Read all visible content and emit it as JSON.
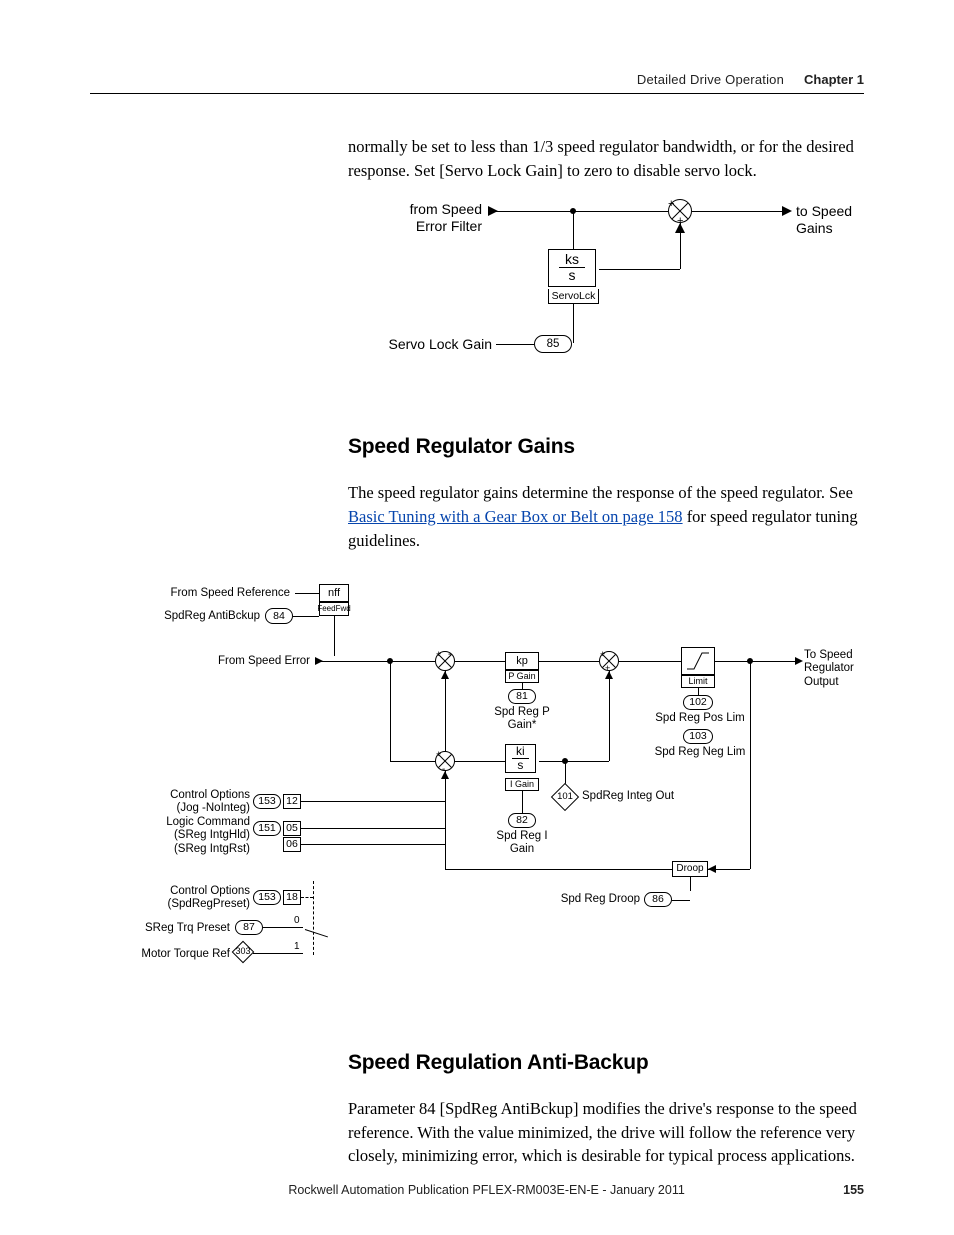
{
  "header": {
    "section": "Detailed Drive Operation",
    "chapter": "Chapter 1"
  },
  "para1": "normally be set to less than 1/3 speed regulator bandwidth, or for the desired response. Set [Servo Lock Gain] to zero to disable servo lock.",
  "diag1": {
    "from_label_a": "from Speed",
    "from_label_b": "Error Filter",
    "to_label": "to Speed Gains",
    "ks": "ks",
    "s": "s",
    "servolck": "ServoLck",
    "servo_lock_gain": "Servo Lock Gain",
    "param85": "85",
    "plus": "+"
  },
  "h3a": "Speed Regulator Gains",
  "para2a": "The speed regulator gains determine the response of the speed regulator. See ",
  "para2_link": "Basic Tuning with a Gear Box or Belt on page 158",
  "para2b": " for speed regulator tuning guidelines.",
  "diag2": {
    "from_speed_ref": "From Speed Reference",
    "spdreg_antibckup": "SpdReg AntiBckup",
    "nff": "nff",
    "feedfwd": "FeedFwd",
    "p84": "84",
    "from_speed_error": "From Speed Error",
    "kp": "kp",
    "pgain": "P Gain",
    "p81": "81",
    "spd_reg_p_gain": "Spd Reg P Gain*",
    "limit": "Limit",
    "to_speed_reg_out_a": "To Speed",
    "to_speed_reg_out_b": "Regulator Output",
    "p102": "102",
    "spd_reg_pos_lim": "Spd Reg Pos Lim",
    "p103": "103",
    "spd_reg_neg_lim": "Spd Reg Neg Lim",
    "ki": "ki",
    "s": "s",
    "igain": "I Gain",
    "p101": "101",
    "spdreg_integ_out": "SpdReg Integ Out",
    "p82": "82",
    "spd_reg_i_gain": "Spd Reg I Gain",
    "control_options_nointeg_a": "Control Options",
    "control_options_nointeg_b": "(Jog -NoInteg)",
    "p153": "153",
    "b12": "12",
    "logic_command_a": "Logic Command",
    "logic_command_b": "(SReg IntgHld)",
    "logic_command_c": "(SReg IntgRst)",
    "p151": "151",
    "b05": "05",
    "b06": "06",
    "droop": "Droop",
    "control_options_preset_a": "Control Options",
    "control_options_preset_b": "(SpdRegPreset)",
    "b18": "18",
    "spd_reg_droop": "Spd Reg Droop",
    "p86": "86",
    "sreg_trq_preset": "SReg Trq Preset",
    "p87": "87",
    "motor_torque_ref": "Motor Torque Ref",
    "p303": "303",
    "sw0": "0",
    "sw1": "1",
    "plus": "+",
    "minus": "-"
  },
  "h3b": "Speed Regulation Anti-Backup",
  "para3": "Parameter 84 [SpdReg AntiBckup] modifies the drive's response to the speed reference. With the value minimized, the drive will follow the reference very closely, minimizing error, which is desirable for typical process applications.",
  "footer": {
    "pub": "Rockwell Automation Publication PFLEX-RM003E-EN-E - January 2011",
    "page": "155"
  }
}
